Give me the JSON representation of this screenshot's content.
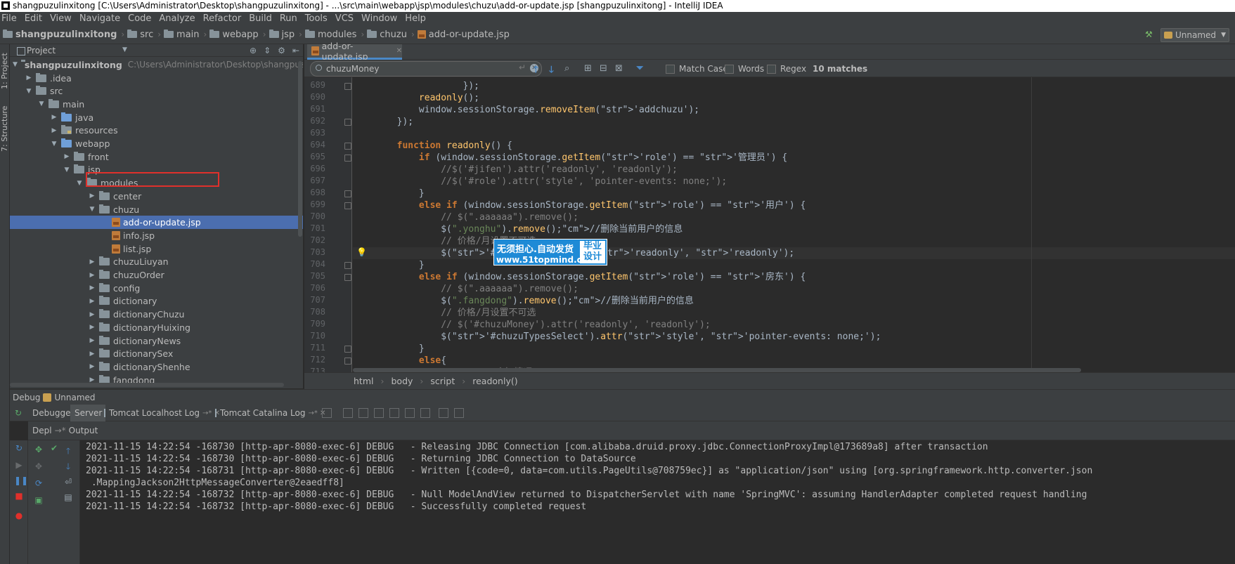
{
  "window": {
    "title": "shangpuzulinxitong [C:\\Users\\Administrator\\Desktop\\shangpuzulinxitong] - ...\\src\\main\\webapp\\jsp\\modules\\chuzu\\add-or-update.jsp [shangpuzulinxitong] - IntelliJ IDEA"
  },
  "menu": [
    "File",
    "Edit",
    "View",
    "Navigate",
    "Code",
    "Analyze",
    "Refactor",
    "Build",
    "Run",
    "Tools",
    "VCS",
    "Window",
    "Help"
  ],
  "breadcrumb": [
    "shangpuzulinxitong",
    "src",
    "main",
    "webapp",
    "jsp",
    "modules",
    "chuzu",
    "add-or-update.jsp"
  ],
  "run_config": "Unnamed",
  "left_strip": {
    "project": "1: Project",
    "structure": "7: Structure"
  },
  "project_panel": {
    "title": "Project",
    "root_path": "C:\\Users\\Administrator\\Desktop\\shangpuzulinxitong",
    "tree": [
      {
        "label": "shangpuzulinxitong",
        "depth": 0,
        "state": "open",
        "kind": "folder",
        "bold": true
      },
      {
        "label": ".idea",
        "depth": 1,
        "state": "closed",
        "kind": "folder"
      },
      {
        "label": "src",
        "depth": 1,
        "state": "open",
        "kind": "folder"
      },
      {
        "label": "main",
        "depth": 2,
        "state": "open",
        "kind": "folder"
      },
      {
        "label": "java",
        "depth": 3,
        "state": "closed",
        "kind": "folder-blue"
      },
      {
        "label": "resources",
        "depth": 3,
        "state": "closed",
        "kind": "folder-res"
      },
      {
        "label": "webapp",
        "depth": 3,
        "state": "open",
        "kind": "folder-blue"
      },
      {
        "label": "front",
        "depth": 4,
        "state": "closed",
        "kind": "folder"
      },
      {
        "label": "jsp",
        "depth": 4,
        "state": "open",
        "kind": "folder"
      },
      {
        "label": "modules",
        "depth": 5,
        "state": "open",
        "kind": "folder"
      },
      {
        "label": "center",
        "depth": 6,
        "state": "closed",
        "kind": "folder"
      },
      {
        "label": "chuzu",
        "depth": 6,
        "state": "open",
        "kind": "folder"
      },
      {
        "label": "add-or-update.jsp",
        "depth": 7,
        "state": "leaf",
        "kind": "jsp",
        "selected": true
      },
      {
        "label": "info.jsp",
        "depth": 7,
        "state": "leaf",
        "kind": "jsp"
      },
      {
        "label": "list.jsp",
        "depth": 7,
        "state": "leaf",
        "kind": "jsp"
      },
      {
        "label": "chuzuLiuyan",
        "depth": 6,
        "state": "closed",
        "kind": "folder"
      },
      {
        "label": "chuzuOrder",
        "depth": 6,
        "state": "closed",
        "kind": "folder"
      },
      {
        "label": "config",
        "depth": 6,
        "state": "closed",
        "kind": "folder"
      },
      {
        "label": "dictionary",
        "depth": 6,
        "state": "closed",
        "kind": "folder"
      },
      {
        "label": "dictionaryChuzu",
        "depth": 6,
        "state": "closed",
        "kind": "folder"
      },
      {
        "label": "dictionaryHuixing",
        "depth": 6,
        "state": "closed",
        "kind": "folder"
      },
      {
        "label": "dictionaryNews",
        "depth": 6,
        "state": "closed",
        "kind": "folder"
      },
      {
        "label": "dictionarySex",
        "depth": 6,
        "state": "closed",
        "kind": "folder"
      },
      {
        "label": "dictionaryShenhe",
        "depth": 6,
        "state": "closed",
        "kind": "folder"
      },
      {
        "label": "fangdong",
        "depth": 6,
        "state": "closed",
        "kind": "folder"
      }
    ]
  },
  "editor": {
    "tab": "add-or-update.jsp",
    "search": {
      "query": "chuzuMoney",
      "options": [
        "Match Case",
        "Words",
        "Regex"
      ],
      "matches": "10 matches"
    },
    "line_numbers": [
      "689",
      "690",
      "691",
      "692",
      "693",
      "694",
      "695",
      "696",
      "697",
      "698",
      "699",
      "700",
      "701",
      "702",
      "703",
      "704",
      "705",
      "706",
      "707",
      "708",
      "709",
      "710",
      "711",
      "712",
      "713"
    ],
    "code_lines": [
      "                    });",
      "            readonly();",
      "            window.sessionStorage.removeItem('addchuzu');",
      "        });",
      "",
      "        function readonly() {",
      "            if (window.sessionStorage.getItem('role') == '管理员') {",
      "                //$('#jifen').attr('readonly', 'readonly');",
      "                //$('#role').attr('style', 'pointer-events: none;');",
      "            }",
      "            else if (window.sessionStorage.getItem('role') == '用户') {",
      "                // $(\".aaaaaa\").remove();",
      "                $(\".yonghu\").remove();//删除当前用户的信息",
      "                // 价格/月设置不可选",
      "                $('#chuzuMoney').attr('readonly', 'readonly');",
      "            }",
      "            else if (window.sessionStorage.getItem('role') == '房东') {",
      "                // $(\".aaaaaa\").remove();",
      "                $(\".fangdong\").remove();//删除当前用户的信息",
      "                // 价格/月设置不可选",
      "                // $('#chuzuMoney').attr('readonly', 'readonly');",
      "                $('#chuzuTypesSelect').attr('style', 'pointer-events: none;');",
      "            }",
      "            else{",
      "                // alert(\"未知情况.......\");"
    ],
    "breadcrumb": [
      "html",
      "body",
      "script",
      "readonly()"
    ]
  },
  "watermark": {
    "main": "无须担心.自动发货",
    "url": "www.51topmind.com",
    "badge_line1": "毕业",
    "badge_line2": "设计"
  },
  "debug": {
    "header_label": "Debug",
    "header_config": "Unnamed",
    "tabs": [
      "Debugger",
      "Server",
      "Tomcat Localhost Log",
      "Tomcat Catalina Log"
    ],
    "subtabs": [
      "Depl",
      "Output"
    ],
    "log_lines": [
      "2021-11-15 14:22:54 -168730 [http-apr-8080-exec-6] DEBUG   - Releasing JDBC Connection [com.alibaba.druid.proxy.jdbc.ConnectionProxyImpl@173689a8] after transaction",
      "2021-11-15 14:22:54 -168730 [http-apr-8080-exec-6] DEBUG   - Returning JDBC Connection to DataSource",
      "2021-11-15 14:22:54 -168731 [http-apr-8080-exec-6] DEBUG   - Written [{code=0, data=com.utils.PageUtils@708759ec}] as \"application/json\" using [org.springframework.http.converter.json",
      " .MappingJackson2HttpMessageConverter@2eaedff8]",
      "2021-11-15 14:22:54 -168732 [http-apr-8080-exec-6] DEBUG   - Null ModelAndView returned to DispatcherServlet with name 'SpringMVC': assuming HandlerAdapter completed request handling",
      "2021-11-15 14:22:54 -168732 [http-apr-8080-exec-6] DEBUG   - Successfully completed request"
    ]
  }
}
